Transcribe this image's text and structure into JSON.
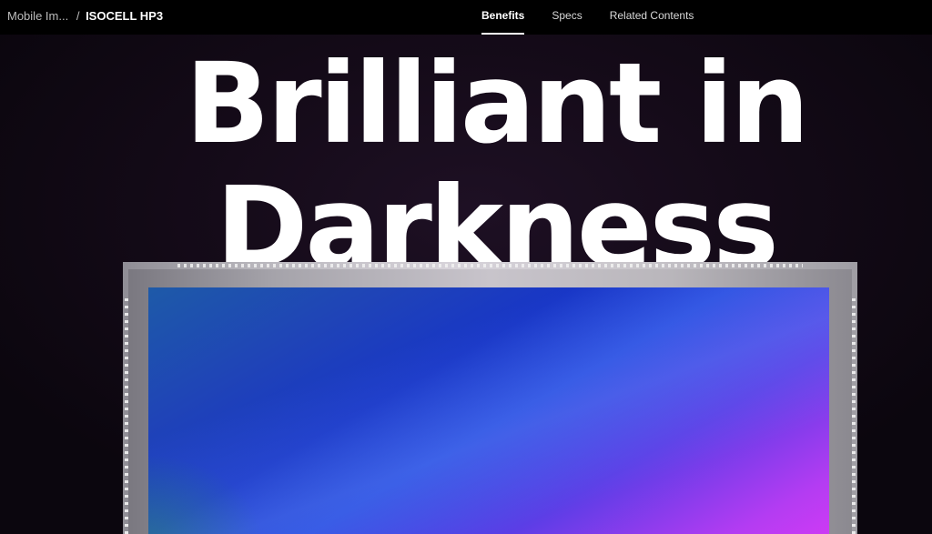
{
  "nav": {
    "breadcrumb_parent": "Mobile Im...",
    "breadcrumb_separator": "/",
    "breadcrumb_current": "ISOCELL HP3",
    "tabs": [
      {
        "label": "Benefits",
        "active": true
      },
      {
        "label": "Specs",
        "active": false
      },
      {
        "label": "Related Contents",
        "active": false
      }
    ]
  },
  "hero": {
    "headline_line1": "Brilliant in",
    "headline_line2": "Darkness"
  },
  "colors": {
    "nav_background": "#000000",
    "page_background": "#150b19",
    "sensor_gradient_start": "#1e5aa8",
    "sensor_gradient_end": "#d13af5"
  }
}
